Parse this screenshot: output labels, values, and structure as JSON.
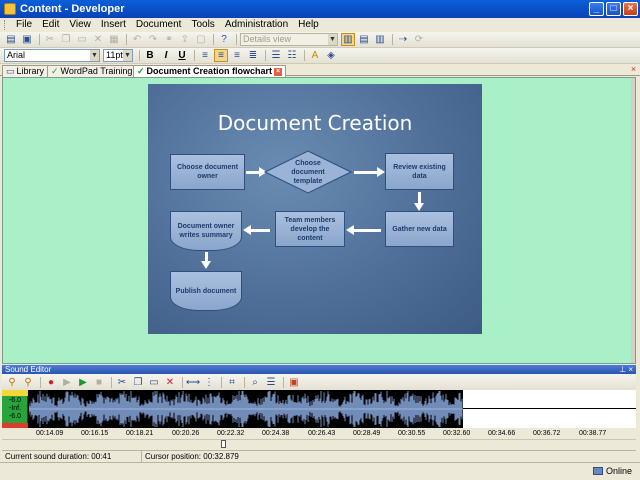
{
  "window": {
    "title": "Content - Developer"
  },
  "menu": [
    "File",
    "Edit",
    "View",
    "Insert",
    "Document",
    "Tools",
    "Administration",
    "Help"
  ],
  "toolbar": {
    "view_combo": "Details view",
    "font_combo": "Arial",
    "size_combo": "11pt",
    "bold": "B",
    "italic": "I",
    "underline": "U"
  },
  "tabs": [
    {
      "label": "Library"
    },
    {
      "label": "WordPad Training"
    },
    {
      "label": "Document Creation flowchart"
    }
  ],
  "slide": {
    "title": "Document Creation",
    "boxes": {
      "choose_owner": "Choose document owner",
      "choose_template": "Choose document template",
      "review_data": "Review existing data",
      "gather_data": "Gather new data",
      "team_develop": "Team members develop the content",
      "owner_summary": "Document owner writes summary",
      "publish": "Publish document"
    }
  },
  "sound_editor": {
    "title": "Sound Editor",
    "header_controls": "p ×",
    "meter": {
      "top": "-6.0",
      "mid": "-Inf.",
      "bot": "-6.0"
    },
    "timeline": [
      "00:14.09",
      "00:16.15",
      "00:18.21",
      "00:20.26",
      "00:22.32",
      "00:24.38",
      "00:26.43",
      "00:28.49",
      "00:30.55",
      "00:32.60",
      "00:34.66",
      "00:36.72",
      "00:38.77"
    ],
    "scroll_marker": "0",
    "duration": "Current sound duration: 00:41",
    "cursor": "Cursor position: 00:32.879"
  },
  "status": {
    "online": "Online"
  }
}
